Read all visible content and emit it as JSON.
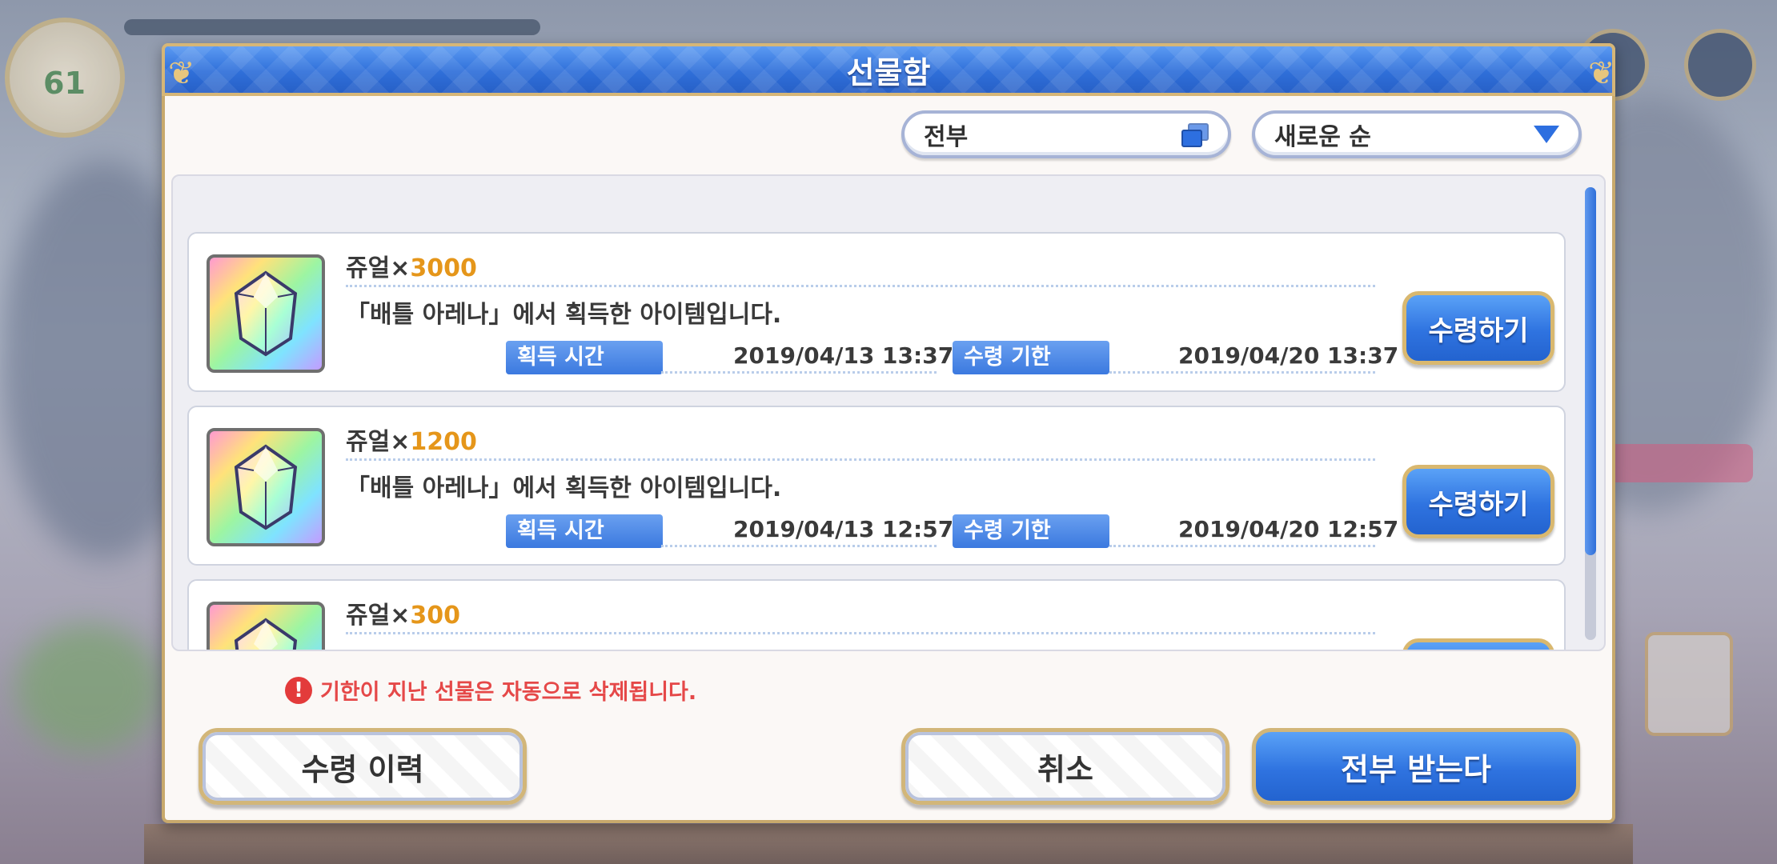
{
  "dialog": {
    "title": "선물함"
  },
  "filters": {
    "category_value": "전부",
    "sort_value": "새로운 순"
  },
  "items": [
    {
      "name": "쥬얼×",
      "quantity": "3000",
      "description": "「배틀 아레나」에서 획득한 아이템입니다.",
      "acquired_label": "획득 시간",
      "acquired_time": "2019/04/13 13:37",
      "deadline_label": "수령 기한",
      "deadline_time": "2019/04/20 13:37",
      "claim_label": "수령하기"
    },
    {
      "name": "쥬얼×",
      "quantity": "1200",
      "description": "「배틀 아레나」에서 획득한 아이템입니다.",
      "acquired_label": "획득 시간",
      "acquired_time": "2019/04/13 12:57",
      "deadline_label": "수령 기한",
      "deadline_time": "2019/04/20 12:57",
      "claim_label": "수령하기"
    },
    {
      "name": "쥬얼×",
      "quantity": "300"
    }
  ],
  "footer": {
    "warning": "기한이 지난 선물은 자동으로 삭제됩니다.",
    "history_label": "수령 이력",
    "cancel_label": "취소",
    "receive_all_label": "전부 받는다"
  },
  "background_hud": {
    "level": "61"
  },
  "colors": {
    "accent_blue": "#2f73e0",
    "gold_border": "#d2b679",
    "quantity_orange": "#e5961a",
    "warning_red": "#e54848"
  }
}
